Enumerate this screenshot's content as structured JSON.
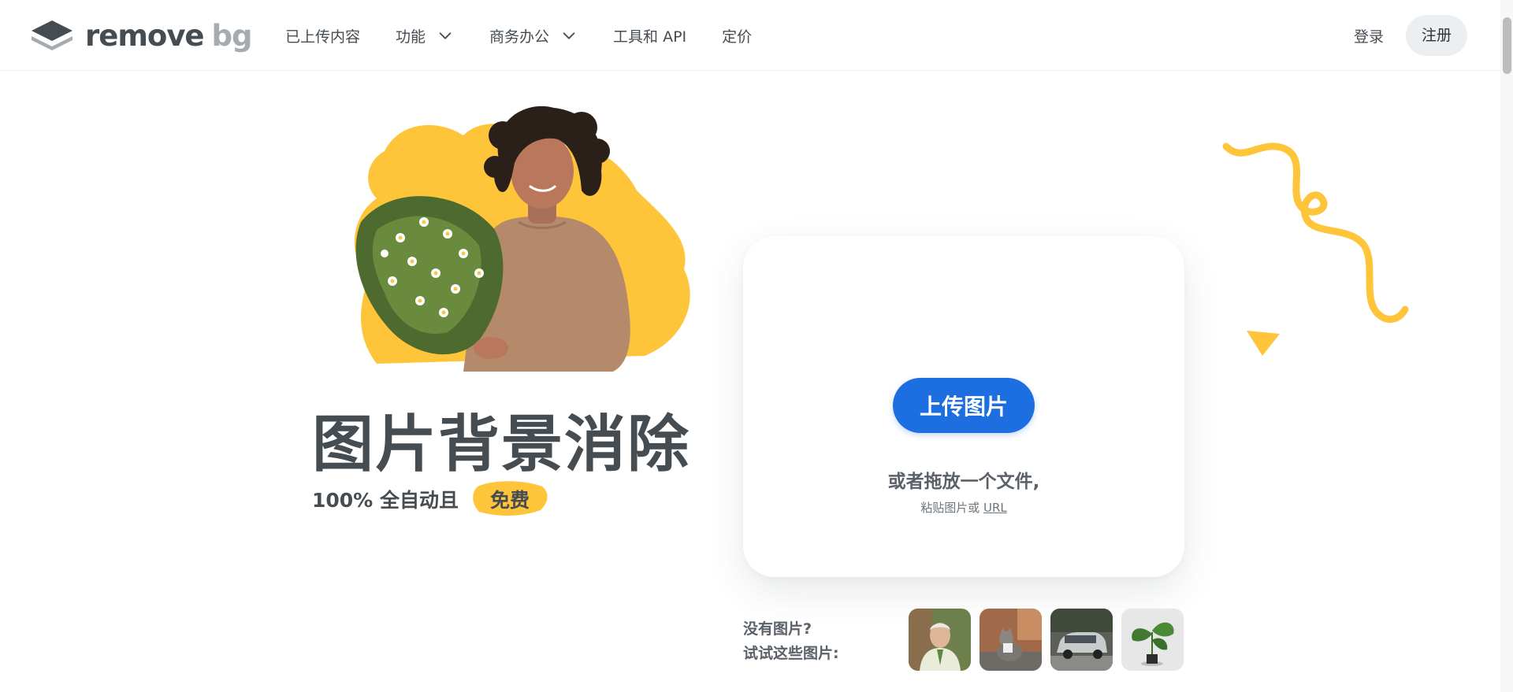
{
  "header": {
    "logo": {
      "word1": "remove",
      "word2": "bg"
    },
    "nav": [
      {
        "label": "已上传内容",
        "has_dropdown": false
      },
      {
        "label": "功能",
        "has_dropdown": true
      },
      {
        "label": "商务办公",
        "has_dropdown": true
      },
      {
        "label": "工具和 API",
        "has_dropdown": false
      },
      {
        "label": "定价",
        "has_dropdown": false
      }
    ],
    "login_label": "登录",
    "signup_label": "注册"
  },
  "hero": {
    "title": "图片背景消除",
    "subtitle_prefix": "100% 全自动且",
    "free_badge": "免费"
  },
  "upload": {
    "button_label": "上传图片",
    "drop_text": "或者拖放一个文件,",
    "paste_prefix": "粘贴图片或",
    "url_link": "URL"
  },
  "samples": {
    "label_line1": "没有图片?",
    "label_line2": "试试这些图片:",
    "items": [
      {
        "icon": "person-photo"
      },
      {
        "icon": "cat-photo"
      },
      {
        "icon": "car-photo"
      },
      {
        "icon": "plant-photo"
      }
    ]
  },
  "colors": {
    "brand_dark": "#454c52",
    "brand_light": "#a6abb0",
    "accent_blue": "#1d6ee0",
    "accent_yellow": "#ffc53a"
  }
}
